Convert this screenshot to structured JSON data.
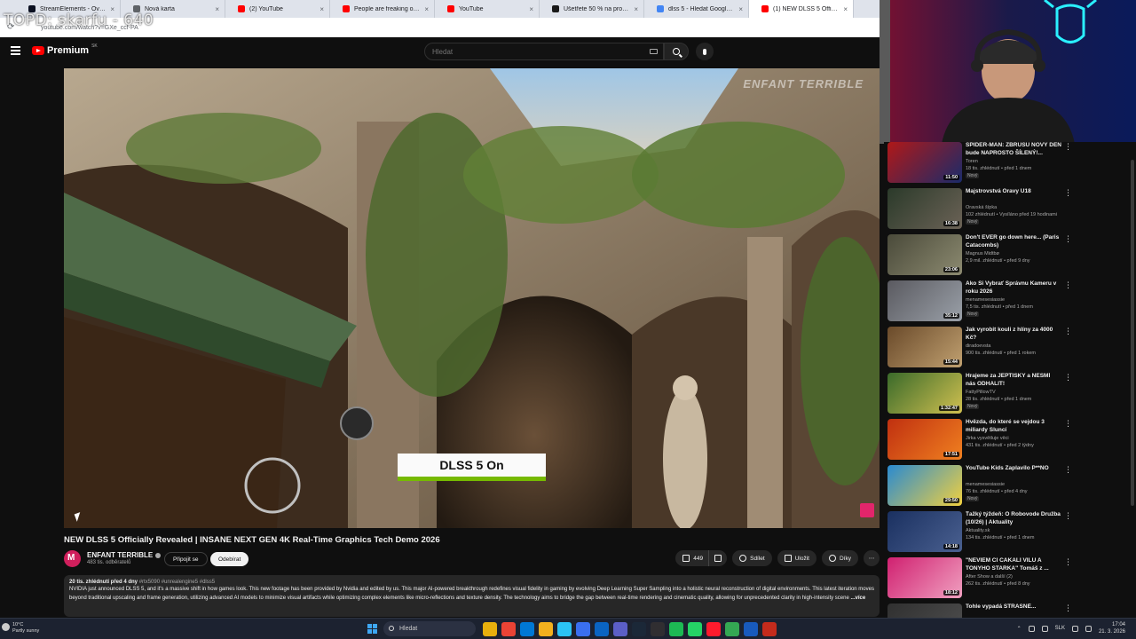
{
  "overlay": {
    "text": "TOPD: skarfu - 640"
  },
  "browser": {
    "tabs": [
      {
        "title": "StreamElements - Overlays",
        "color": "#0b1021"
      },
      {
        "title": "Nová karta",
        "color": "#5f6368"
      },
      {
        "title": "(2) YouTube",
        "color": "#ff0000"
      },
      {
        "title": "People are freaking out now...",
        "color": "#ff0000"
      },
      {
        "title": "YouTube",
        "color": "#ff0000"
      },
      {
        "title": "Ušetřete 50 % na produktu PA...",
        "color": "#1a1a1a"
      },
      {
        "title": "dlss 5 - Hledat Googlem",
        "color": "#4285f4"
      },
      {
        "title": "(1) NEW DLSS 5 Officially Reve...",
        "color": "#ff0000",
        "active": true
      }
    ],
    "url": "youtube.com/watch?v=GXe_ccf-PA"
  },
  "youtube": {
    "logo": "Premium",
    "logo_country": "SK",
    "search_placeholder": "Hledat"
  },
  "player": {
    "caption": "DLSS 5 On",
    "watermark": "ENFANT TERRIBLE"
  },
  "video": {
    "title": "NEW DLSS 5 Officially Revealed | INSANE NEXT GEN 4K Real-Time Graphics Tech Demo 2026",
    "channel_name": "ENFANT TERRIBLE",
    "subscribers": "483 tis. odběratelů",
    "join_label": "Připojit se",
    "subscribe_label": "Odebírat",
    "likes": "449",
    "share_label": "Sdílet",
    "save_label": "Uložit",
    "thanks_label": "Díky",
    "description": {
      "stats": "20 tis. zhlédnutí  před 4 dny",
      "tags": "#rtx5090 #unrealengine5 #dlss5",
      "text": "NVIDIA just announced DLSS 5, and it's a massive shift in how games look. This new footage has been provided by Nvidia and edited by us. This major AI-powered breakthrough redefines visual fidelity in gaming by evolving Deep Learning Super Sampling into a holistic neural reconstruction of digital environments. This latest iteration moves beyond traditional upscaling and frame generation, utilizing advanced AI models to minimize visual artifacts while optimizing complex elements like micro-reflections and texture density. The technology aims to bridge the gap between real-time rendering and cinematic quality, allowing for unprecedented clarity in high-intensity scene",
      "more": "...více"
    }
  },
  "recommendations": [
    {
      "title": "SPIDER-MAN: ZBRUSU NOVÝ DEN bude NAPROSTO ŠÍLENÝ!...",
      "channel": "Toren",
      "stats": "18 tis. zhlédnutí • před 1 dnem",
      "badge": "Nový",
      "duration": "11:50",
      "colors": [
        "#b01818",
        "#1a2b6a"
      ]
    },
    {
      "title": "Majstrovstvá Oravy U18",
      "channel": "Oravská šípka",
      "stats": "102 zhlédnutí • Vysíláno před 19 hodinami",
      "badge": "Nový",
      "duration": "16:38",
      "colors": [
        "#2b3a2a",
        "#6b6256"
      ]
    },
    {
      "title": "Don't EVER go down here... (Paris Catacombs)",
      "channel": "Magnus Midtbø",
      "stats": "2,9 mil. zhlédnutí • před 9 dny",
      "badge": "",
      "duration": "23:06",
      "colors": [
        "#4a4a3a",
        "#8c8a70"
      ]
    },
    {
      "title": "Ako Si Vybrať Správnu Kameru v roku 2026",
      "channel": "menamesesiassie",
      "stats": "7,5 tis. zhlédnutí • před 1 dnem",
      "badge": "Nový",
      "duration": "35:12",
      "colors": [
        "#5a5a60",
        "#9aa0a8"
      ]
    },
    {
      "title": "Jak vyrobit kouli z hlíny za 4000 Kč?",
      "channel": "diradoevsta",
      "stats": "900 tis. zhlédnutí • před 1 rokem",
      "badge": "",
      "duration": "15:44",
      "colors": [
        "#6a4a2a",
        "#c0a070"
      ]
    },
    {
      "title": "Hrajeme za JEPTIŠKY a NESMÍ nás ODHALIT!",
      "channel": "FattyPillowTV",
      "stats": "28 tis. zhlédnutí • před 1 dnem",
      "badge": "Nový",
      "duration": "1:32:47",
      "colors": [
        "#3a6a2a",
        "#d0c050"
      ]
    },
    {
      "title": "Hvězda, do které se vejdou 3 miliardy Sluncí",
      "channel": "Jirka vysvětluje věci",
      "stats": "431 tis. zhlédnutí • před 2 týdny",
      "badge": "",
      "duration": "17:51",
      "colors": [
        "#c03010",
        "#f08020"
      ]
    },
    {
      "title": "YouTube Kids Zaplavilo P**NO",
      "channel": "menamesesiassie",
      "stats": "76 tis. zhlédnutí • před 4 dny",
      "badge": "Nový",
      "duration": "29:50",
      "colors": [
        "#2a8ad0",
        "#f0d040"
      ]
    },
    {
      "title": "Ťažký týždeň: O Robovode Družba (10/26) | Aktuality",
      "channel": "Aktuality.sk",
      "stats": "134 tis. zhlédnutí • před 1 dnem",
      "badge": "",
      "duration": "14:18",
      "colors": [
        "#1a3060",
        "#4a6090"
      ]
    },
    {
      "title": "\"NEVIEM ČI ČAKALI VILU A TONYHO STARKA\" Tomáš z ...",
      "channel": "After Show a další (2)",
      "stats": "262 tis. zhlédnutí • před 8 dny",
      "badge": "",
      "duration": "18:12",
      "colors": [
        "#d02070",
        "#f0a0c0"
      ]
    },
    {
      "title": "Tohle vypadá STRAŠNĚ...",
      "channel": "",
      "stats": "",
      "badge": "",
      "duration": "",
      "colors": [
        "#303030",
        "#505050"
      ]
    }
  ],
  "taskbar": {
    "weather_temp": "10°C",
    "weather_desc": "Partly sunny",
    "search_label": "Hledat",
    "lang": "SLK",
    "time": "17:04",
    "date": "21. 3. 2026",
    "icons": [
      "files",
      "chrome",
      "mail",
      "explorer",
      "edge",
      "store",
      "outlook",
      "teams",
      "steam",
      "obs",
      "spotify",
      "whatsapp",
      "opera",
      "chrome2",
      "word",
      "notes"
    ],
    "icon_colors": [
      "#e8b00d",
      "#ea4335",
      "#0078d4",
      "#f2b01e",
      "#2bc3f5",
      "#3a6ff0",
      "#0a64c2",
      "#5b5fc7",
      "#1b2838",
      "#302e31",
      "#1db954",
      "#25d366",
      "#ff1b2d",
      "#34a853",
      "#185abd",
      "#c42b1c"
    ]
  }
}
